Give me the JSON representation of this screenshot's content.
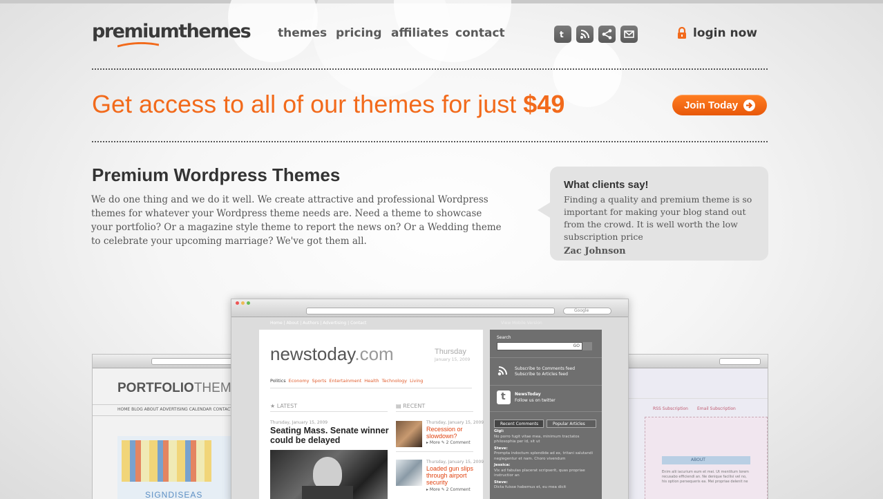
{
  "header": {
    "logo": "premiumthemes",
    "nav": [
      {
        "label": "themes"
      },
      {
        "label": "pricing"
      },
      {
        "label": "affiliates"
      },
      {
        "label": "contact"
      }
    ],
    "social_icons": [
      "twitter-icon",
      "rss-icon",
      "share-icon",
      "email-icon"
    ],
    "login_label": "login now"
  },
  "promo": {
    "text": "Get access to all of our themes for just ",
    "price": "$49",
    "join_label": "Join Today"
  },
  "intro": {
    "title": "Premium Wordpress Themes",
    "body": "We do one thing and we do it well. We create attractive and professional Wordpress themes for whatever your Wordpress theme needs are. Need a theme to showcase your portfolio? Or a magazine style theme to report the news on? Or a Wedding theme to celebrate your upcoming marriage? We've got them all."
  },
  "testimonial": {
    "title": "What clients say!",
    "text": "Finding a quality and premium theme is so important for making your blog stand out from the crowd. It is well worth the low subscription price",
    "author": "Zac Johnson"
  },
  "showcase": {
    "left": {
      "title": "PORTFOLIO",
      "title_suffix": "THEME",
      "nav": "HOME   BLOG   ABOUT   ADVERTISING   CALENDAR   CONTACT"
    },
    "main": {
      "top_nav": "Home  |  About  |  Authors  |  Advertising  |  Contact",
      "mobile_link": "View Mobile Version",
      "site_name": "newstoday",
      "site_tld": ".com",
      "day": "Thursday",
      "date": "January 15, 2009",
      "categories": [
        "Politics",
        "Economy",
        "Sports",
        "Entertainment",
        "Health",
        "Technology",
        "Living"
      ],
      "latest_label": "LATEST",
      "recent_label": "RECENT",
      "headline_date": "Thursday, January 15, 2009",
      "headline": "Seating Mass. Senate winner could be delayed",
      "recent": [
        {
          "date": "Thursday, January 15, 2009",
          "title": "Recession or slowdown?",
          "more": "More",
          "comments": "2 Comment"
        },
        {
          "date": "Thursday, January 15, 2009",
          "title": "Loaded gun slips through airport security",
          "more": "More",
          "comments": "2 Comment"
        }
      ],
      "search_label": "Search",
      "search_button": "GO",
      "google_placeholder": "Google",
      "subscribe_comments": "Subscribe to Comments feed",
      "subscribe_articles": "Subscribe to Articles feed",
      "twitter_name": "NewsToday",
      "twitter_follow": "Follow us on twitter",
      "tabs": [
        "Recent Comments",
        "Popular Articles"
      ],
      "comments": [
        {
          "name": "Gigi:",
          "text": "No porro fugit vitae mea, minimum tractatos philosophia per id, sit ut"
        },
        {
          "name": "Steve:",
          "text": "Prompta indoctum splendide ad ex, tritani salutandi neglegentur et nam. Choro vivendum"
        },
        {
          "name": "Jessica:",
          "text": "Vix ad fabulas placerat scripserit, quas propriae instructior an"
        },
        {
          "name": "Steve:",
          "text": "Dicta fuisse habemus et, eu mea dicit"
        }
      ]
    },
    "right": {
      "rss": "RSS Subscription",
      "email": "Email Subscription",
      "about": "ABOUT",
      "about_text": "Enim alii iacurium eum et mei. Ut mentitum lorem recusabo efficiendi an. Ne denique facilisi vel no, his option persequeris ea. Mei propriae delenit ne"
    }
  },
  "colors": {
    "accent": "#f26a1b",
    "text_dark": "#333333",
    "quote_bg": "#e3e3e3"
  }
}
